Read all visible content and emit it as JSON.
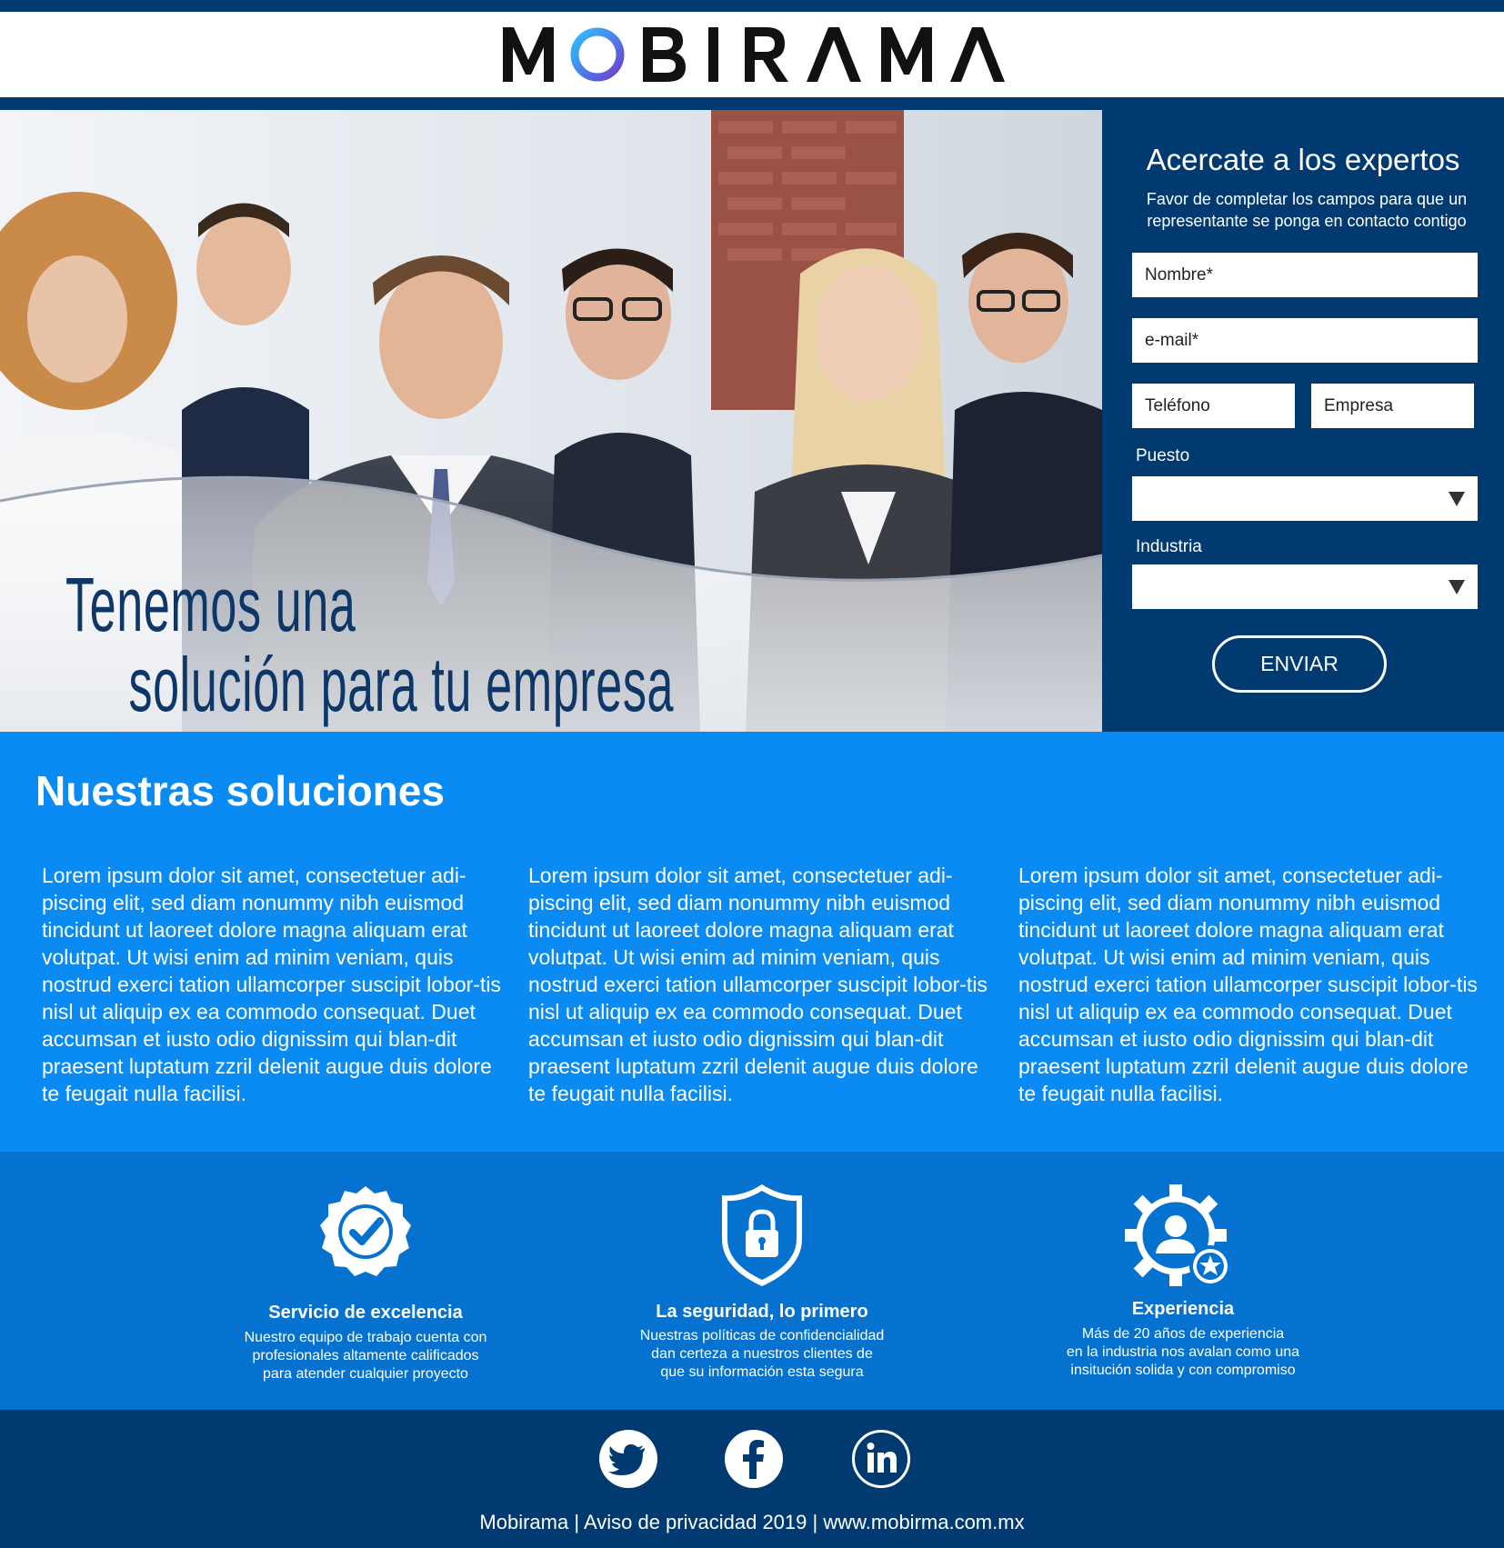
{
  "brand": {
    "logo_text": "MOBIRAMA"
  },
  "hero": {
    "title_line1": "Tenemos una",
    "title_line2": "solución para tu empresa"
  },
  "form": {
    "title": "Acercate a los expertos",
    "subtitle": "Favor de completar los campos para que un representante se ponga en contacto contigo",
    "nombre_placeholder": "Nombre*",
    "email_placeholder": "e-mail*",
    "telefono_placeholder": "Teléfono",
    "empresa_placeholder": "Empresa",
    "puesto_label": "Puesto",
    "puesto_value": "",
    "industria_label": "Industria",
    "industria_value": "",
    "submit_label": "ENVIAR"
  },
  "solutions": {
    "title": "Nuestras soluciones",
    "columns": [
      "Lorem ipsum dolor sit amet, consectetuer adi-piscing elit, sed diam nonummy nibh euismod tincidunt ut laoreet dolore magna aliquam erat volutpat. Ut wisi enim ad minim veniam, quis nostrud exerci tation ullamcorper suscipit lobor-tis nisl ut aliquip ex ea commodo consequat. Duet accumsan et iusto odio dignissim qui blan-dit praesent luptatum zzril delenit augue duis dolore te feugait nulla facilisi.",
      "Lorem ipsum dolor sit amet, consectetuer adi-piscing elit, sed diam nonummy nibh euismod tincidunt ut laoreet dolore magna aliquam erat volutpat. Ut wisi enim ad minim veniam, quis nostrud exerci tation ullamcorper suscipit lobor-tis nisl ut aliquip ex ea commodo consequat. Duet accumsan et iusto odio dignissim qui blan-dit praesent luptatum zzril delenit augue duis dolore te feugait nulla facilisi.",
      "Lorem ipsum dolor sit amet, consectetuer adi-piscing elit, sed diam nonummy nibh euismod tincidunt ut laoreet dolore magna aliquam erat volutpat. Ut wisi enim ad minim veniam, quis nostrud exerci tation ullamcorper suscipit lobor-tis nisl ut aliquip ex ea commodo consequat. Duet accumsan et iusto odio dignissim qui blan-dit praesent luptatum zzril delenit augue duis dolore te feugait nulla facilisi."
    ]
  },
  "features": [
    {
      "icon": "badge-check-icon",
      "title": "Servicio de excelencia",
      "desc_lines": [
        "Nuestro equipo de trabajo cuenta con",
        "profesionales altamente calificados",
        "para atender cualquier proyecto"
      ]
    },
    {
      "icon": "shield-lock-icon",
      "title": "La seguridad, lo primero",
      "desc_lines": [
        "Nuestras políticas de confidencialidad",
        "dan certeza a nuestros clientes de",
        "que su información esta segura"
      ]
    },
    {
      "icon": "gear-user-star-icon",
      "title": "Experiencia",
      "desc_lines": [
        "Más de 20 años de experiencia",
        "en la industria nos avalan como una",
        "insitución solida y con compromiso"
      ]
    }
  ],
  "footer": {
    "social": [
      "twitter-icon",
      "facebook-icon",
      "linkedin-icon"
    ],
    "text": "Mobirama | Aviso de privacidad 2019 | www.mobirma.com.mx"
  },
  "colors": {
    "navy": "#003a70",
    "bright_blue": "#0a8bf3",
    "mid_blue": "#0572d0",
    "logo_o_gradient": [
      "#2ec0ff",
      "#6b3fd1"
    ]
  }
}
